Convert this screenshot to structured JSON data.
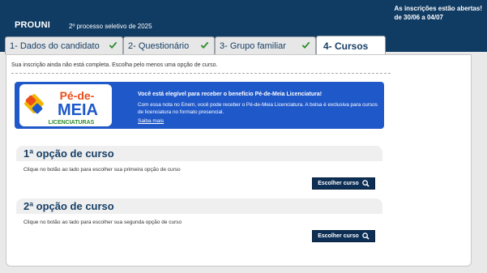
{
  "header": {
    "brand": "PROUNI",
    "process": "2º processo seletivo de 2025",
    "notice_line1": "As inscrições estão abertas!",
    "notice_line2": "de 30/06 a 04/07"
  },
  "tabs": [
    {
      "label": "1- Dados do candidato",
      "completed": true
    },
    {
      "label": "2- Questionário",
      "completed": true
    },
    {
      "label": "3- Grupo familiar",
      "completed": true
    },
    {
      "label": "4- Cursos",
      "active": true
    }
  ],
  "status": {
    "text": "Sua inscrição ainda não está completa. Escolha pelo menos uma opção de curso."
  },
  "banner": {
    "logo_text_top": "Pé-de-",
    "logo_text_mid": "MEIA",
    "logo_text_bottom": "LICENCIATURAS",
    "title": "Você está elegível para receber o benefício Pé-de-Meia Licenciatura!",
    "body": "Com essa nota no Enem, você pode receber o Pé-de-Meia Licenciatura. A bolsa é exclusiva para cursos de licenciatura no formato presencial.",
    "link": "Saiba mais",
    "color": "#1f58c9"
  },
  "courses": [
    {
      "title": "1ª opção de curso",
      "hint": "Clique no botão ao lado para escolher sua primeira opção de curso",
      "button": "Escolher curso"
    },
    {
      "title": "2ª opção de curso",
      "hint": "Clique no botão ao lado para escolher sua segunda opção de curso",
      "button": "Escolher curso"
    }
  ],
  "colors": {
    "header_bg": "#103b63",
    "check_green": "#2e8b2e",
    "button_bg": "#0d2f55"
  }
}
